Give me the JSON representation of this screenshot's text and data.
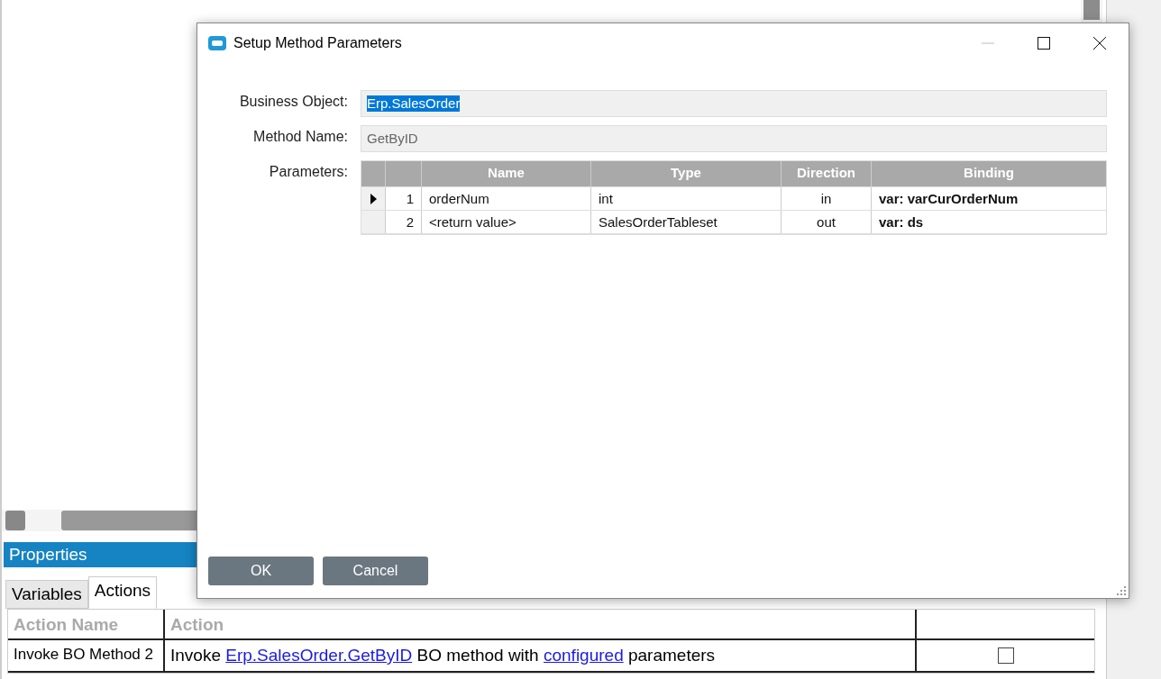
{
  "background": {
    "properties_title": "Properties",
    "tabs": [
      {
        "label": "Variables",
        "selected": false
      },
      {
        "label": "Actions",
        "selected": true
      }
    ],
    "table": {
      "columns": [
        "Action Name",
        "Action"
      ],
      "rows": [
        {
          "action_name": "Invoke BO Method 2",
          "action": [
            {
              "kind": "text",
              "text": "Invoke "
            },
            {
              "kind": "link",
              "text": "Erp.SalesOrder.GetByID"
            },
            {
              "kind": "text",
              "text": " BO method with "
            },
            {
              "kind": "link",
              "text": "configured"
            },
            {
              "kind": "text",
              "text": " parameters"
            }
          ],
          "terminate_on_error": false
        }
      ]
    }
  },
  "dialog": {
    "title": "Setup Method Parameters",
    "fields": [
      {
        "label": "Business Object:",
        "value": "Erp.SalesOrder",
        "selected": true
      },
      {
        "label": "Method Name:",
        "value": "GetByID",
        "selected": false
      }
    ],
    "parameters": {
      "label": "Parameters:",
      "columns": [
        "Name",
        "Type",
        "Direction",
        "Binding"
      ],
      "rows": [
        {
          "current": true,
          "number": "1",
          "name": "orderNum",
          "type": "int",
          "direction": "in",
          "binding": "var: varCurOrderNum"
        },
        {
          "current": false,
          "number": "2",
          "name": "<return value>",
          "type": "SalesOrderTableset",
          "direction": "out",
          "binding": "var: ds"
        }
      ]
    },
    "buttons": [
      "OK",
      "Cancel"
    ]
  }
}
